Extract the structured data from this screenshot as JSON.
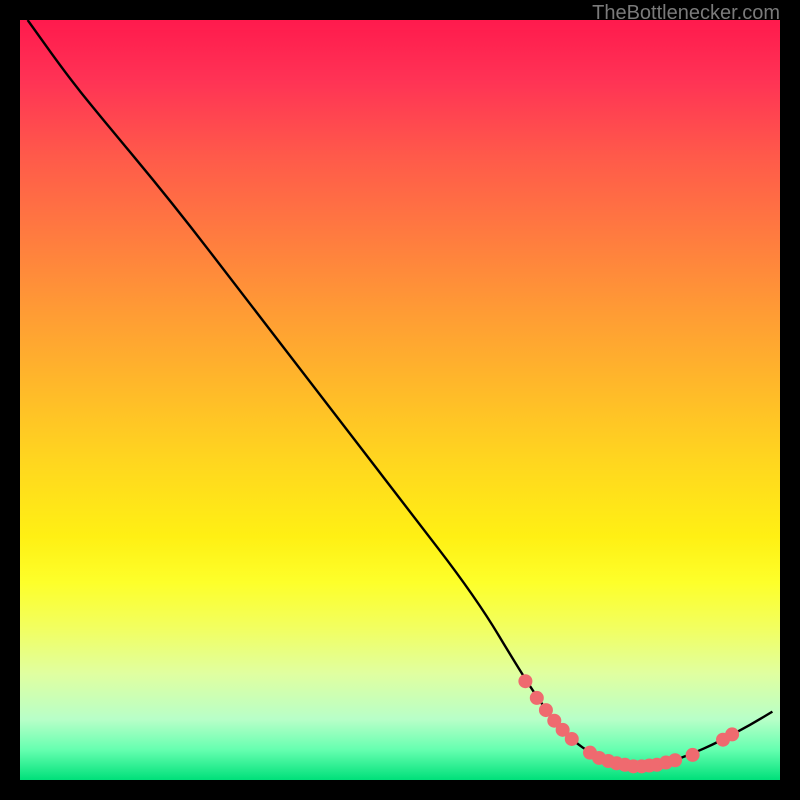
{
  "attribution": "TheBottlenecker.com",
  "colors": {
    "curve": "#000000",
    "marker_fill": "#ef6a6f",
    "marker_stroke": "#d84a54"
  },
  "chart_data": {
    "type": "line",
    "title": "",
    "xlabel": "",
    "ylabel": "",
    "xlim": [
      0,
      100
    ],
    "ylim": [
      0,
      100
    ],
    "curve": [
      {
        "x": 1.0,
        "y": 100.0
      },
      {
        "x": 6.0,
        "y": 93.0
      },
      {
        "x": 10.0,
        "y": 88.0
      },
      {
        "x": 20.0,
        "y": 76.0
      },
      {
        "x": 30.0,
        "y": 63.0
      },
      {
        "x": 40.0,
        "y": 50.0
      },
      {
        "x": 50.0,
        "y": 37.0
      },
      {
        "x": 60.0,
        "y": 24.0
      },
      {
        "x": 66.0,
        "y": 14.0
      },
      {
        "x": 69.0,
        "y": 9.5
      },
      {
        "x": 71.0,
        "y": 7.0
      },
      {
        "x": 73.0,
        "y": 5.0
      },
      {
        "x": 75.0,
        "y": 3.6
      },
      {
        "x": 77.0,
        "y": 2.6
      },
      {
        "x": 79.0,
        "y": 2.0
      },
      {
        "x": 81.0,
        "y": 1.8
      },
      {
        "x": 83.0,
        "y": 1.9
      },
      {
        "x": 85.0,
        "y": 2.3
      },
      {
        "x": 87.0,
        "y": 2.9
      },
      {
        "x": 89.0,
        "y": 3.7
      },
      {
        "x": 91.0,
        "y": 4.6
      },
      {
        "x": 93.0,
        "y": 5.6
      },
      {
        "x": 96.0,
        "y": 7.2
      },
      {
        "x": 99.0,
        "y": 9.0
      }
    ],
    "markers": [
      {
        "x": 66.5,
        "y": 13.0
      },
      {
        "x": 68.0,
        "y": 10.8
      },
      {
        "x": 69.2,
        "y": 9.2
      },
      {
        "x": 70.3,
        "y": 7.8
      },
      {
        "x": 71.4,
        "y": 6.6
      },
      {
        "x": 72.6,
        "y": 5.4
      },
      {
        "x": 75.0,
        "y": 3.6
      },
      {
        "x": 76.2,
        "y": 2.9
      },
      {
        "x": 77.4,
        "y": 2.5
      },
      {
        "x": 78.5,
        "y": 2.2
      },
      {
        "x": 79.6,
        "y": 2.0
      },
      {
        "x": 80.7,
        "y": 1.8
      },
      {
        "x": 81.8,
        "y": 1.8
      },
      {
        "x": 82.8,
        "y": 1.9
      },
      {
        "x": 83.8,
        "y": 2.0
      },
      {
        "x": 85.0,
        "y": 2.3
      },
      {
        "x": 86.2,
        "y": 2.6
      },
      {
        "x": 88.5,
        "y": 3.3
      },
      {
        "x": 92.5,
        "y": 5.3
      },
      {
        "x": 93.7,
        "y": 6.0
      }
    ],
    "marker_radius": 7
  }
}
